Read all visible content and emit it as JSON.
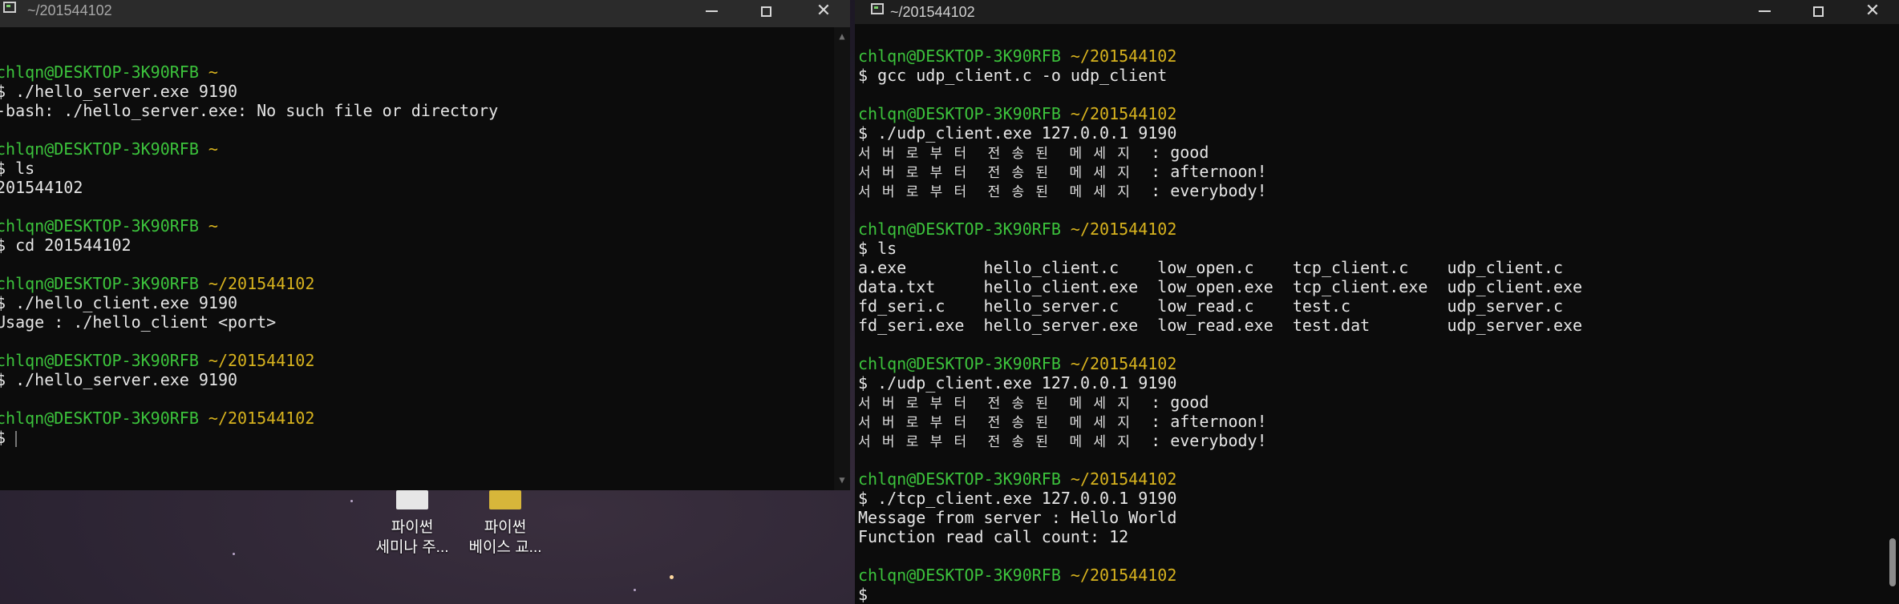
{
  "desktop": {
    "icons": [
      {
        "line1": "파이썬",
        "line2": "세미나 주...",
        "color": "#e6e6e6"
      },
      {
        "line1": "파이썬",
        "line2": "베이스 교...",
        "color": "#d7b63a"
      }
    ]
  },
  "left_terminal": {
    "title": "~/201544102",
    "lines": [
      [],
      [
        [
          "u",
          "chlqn@DESKTOP-3K90RFB "
        ],
        [
          "p",
          "~"
        ]
      ],
      [
        [
          "t",
          "$ ./hello_server.exe 9190"
        ]
      ],
      [
        [
          "t",
          "-bash: ./hello_server.exe: No such file or directory"
        ]
      ],
      [],
      [
        [
          "u",
          "chlqn@DESKTOP-3K90RFB "
        ],
        [
          "p",
          "~"
        ]
      ],
      [
        [
          "t",
          "$ ls"
        ]
      ],
      [
        [
          "t",
          "201544102"
        ]
      ],
      [],
      [
        [
          "u",
          "chlqn@DESKTOP-3K90RFB "
        ],
        [
          "p",
          "~"
        ]
      ],
      [
        [
          "t",
          "$ cd 201544102"
        ]
      ],
      [],
      [
        [
          "u",
          "chlqn@DESKTOP-3K90RFB "
        ],
        [
          "p",
          "~/201544102"
        ]
      ],
      [
        [
          "t",
          "$ ./hello_client.exe 9190"
        ]
      ],
      [
        [
          "t",
          "Usage : ./hello_client <port>"
        ]
      ],
      [],
      [
        [
          "u",
          "chlqn@DESKTOP-3K90RFB "
        ],
        [
          "p",
          "~/201544102"
        ]
      ],
      [
        [
          "t",
          "$ ./hello_server.exe 9190"
        ]
      ],
      [],
      [
        [
          "u",
          "chlqn@DESKTOP-3K90RFB "
        ],
        [
          "p",
          "~/201544102"
        ]
      ],
      [
        [
          "t",
          "$ "
        ],
        [
          "c",
          ""
        ]
      ]
    ]
  },
  "right_terminal": {
    "title": "~/201544102",
    "lines": [
      [
        [
          "u",
          "chlqn@DESKTOP-3K90RFB "
        ],
        [
          "p",
          "~/201544102"
        ]
      ],
      [
        [
          "t",
          "$ gcc udp_client.c -o udp_client"
        ]
      ],
      [],
      [
        [
          "u",
          "chlqn@DESKTOP-3K90RFB "
        ],
        [
          "p",
          "~/201544102"
        ]
      ],
      [
        [
          "t",
          "$ ./udp_client.exe 127.0.0.1 9190"
        ]
      ],
      [
        [
          "k",
          "서 버 로 부 터  전 송 된  메 세 지 "
        ],
        [
          "t",
          " : good"
        ]
      ],
      [
        [
          "k",
          "서 버 로 부 터  전 송 된  메 세 지 "
        ],
        [
          "t",
          " : afternoon!"
        ]
      ],
      [
        [
          "k",
          "서 버 로 부 터  전 송 된  메 세 지 "
        ],
        [
          "t",
          " : everybody!"
        ]
      ],
      [],
      [
        [
          "u",
          "chlqn@DESKTOP-3K90RFB "
        ],
        [
          "p",
          "~/201544102"
        ]
      ],
      [
        [
          "t",
          "$ ls"
        ]
      ],
      [
        [
          "t",
          "a.exe        hello_client.c    low_open.c    tcp_client.c    udp_client.c"
        ]
      ],
      [
        [
          "t",
          "data.txt     hello_client.exe  low_open.exe  tcp_client.exe  udp_client.exe"
        ]
      ],
      [
        [
          "t",
          "fd_seri.c    hello_server.c    low_read.c    test.c          udp_server.c"
        ]
      ],
      [
        [
          "t",
          "fd_seri.exe  hello_server.exe  low_read.exe  test.dat        udp_server.exe"
        ]
      ],
      [],
      [
        [
          "u",
          "chlqn@DESKTOP-3K90RFB "
        ],
        [
          "p",
          "~/201544102"
        ]
      ],
      [
        [
          "t",
          "$ ./udp_client.exe 127.0.0.1 9190"
        ]
      ],
      [
        [
          "k",
          "서 버 로 부 터  전 송 된  메 세 지 "
        ],
        [
          "t",
          " : good"
        ]
      ],
      [
        [
          "k",
          "서 버 로 부 터  전 송 된  메 세 지 "
        ],
        [
          "t",
          " : afternoon!"
        ]
      ],
      [
        [
          "k",
          "서 버 로 부 터  전 송 된  메 세 지 "
        ],
        [
          "t",
          " : everybody!"
        ]
      ],
      [],
      [
        [
          "u",
          "chlqn@DESKTOP-3K90RFB "
        ],
        [
          "p",
          "~/201544102"
        ]
      ],
      [
        [
          "t",
          "$ ./tcp_client.exe 127.0.0.1 9190"
        ]
      ],
      [
        [
          "t",
          "Message from server : Hello World"
        ]
      ],
      [
        [
          "t",
          "Function read call count: 12"
        ]
      ],
      [],
      [
        [
          "u",
          "chlqn@DESKTOP-3K90RFB "
        ],
        [
          "p",
          "~/201544102"
        ]
      ],
      [
        [
          "t",
          "$"
        ]
      ]
    ]
  }
}
